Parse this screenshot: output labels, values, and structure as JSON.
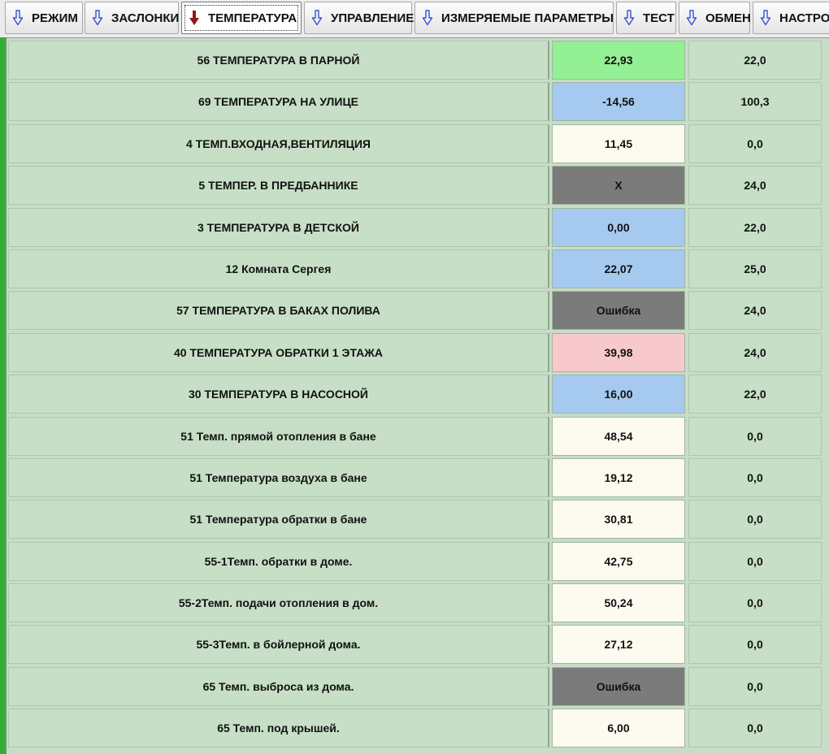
{
  "tabs": [
    {
      "label": "РЕЖИМ",
      "active": false,
      "icon": "arrow-down-icon"
    },
    {
      "label": "ЗАСЛОНКИ",
      "active": false,
      "icon": "arrow-down-icon"
    },
    {
      "label": "ТЕМПЕРАТУРА",
      "active": true,
      "icon": "arrow-down-filled-icon"
    },
    {
      "label": "УПРАВЛЕНИЕ",
      "active": false,
      "icon": "arrow-down-icon"
    },
    {
      "label": "ИЗМЕРЯЕМЫЕ ПАРАМЕТРЫ",
      "active": false,
      "icon": "arrow-down-icon"
    },
    {
      "label": "ТЕСТ",
      "active": false,
      "icon": "arrow-down-icon"
    },
    {
      "label": "ОБМЕН",
      "active": false,
      "icon": "arrow-down-icon"
    },
    {
      "label": "НАСТРО",
      "active": false,
      "icon": "arrow-down-icon"
    }
  ],
  "colors": {
    "green": "#94f094",
    "blue": "#a6c9ef",
    "white": "#fdfaf0",
    "gray": "#7b7b7b",
    "pink": "#f7c9cc",
    "row_bg": "#c6dfc6",
    "active_arrow": "#8b1a1a",
    "inactive_arrow": "#3a4fd8"
  },
  "rows": [
    {
      "name": "56 ТЕМПЕРАТУРА В ПАРНОЙ",
      "value": "22,93",
      "status": "green",
      "setpoint": "22,0"
    },
    {
      "name": "69 ТЕМПЕРАТУРА НА УЛИЦЕ",
      "value": "-14,56",
      "status": "blue",
      "setpoint": "100,3"
    },
    {
      "name": "4 ТЕМП.ВХОДНАЯ,ВЕНТИЛЯЦИЯ",
      "value": "11,45",
      "status": "white",
      "setpoint": "0,0"
    },
    {
      "name": "5 ТЕМПЕР. В ПРЕДБАННИКЕ",
      "value": "X",
      "status": "gray",
      "setpoint": "24,0"
    },
    {
      "name": "3 ТЕМПЕРАТУРА В ДЕТСКОЙ",
      "value": "0,00",
      "status": "blue",
      "setpoint": "22,0"
    },
    {
      "name": "12 Комната Сергея",
      "value": "22,07",
      "status": "blue",
      "setpoint": "25,0"
    },
    {
      "name": "57 ТЕМПЕРАТУРА В БАКАХ ПОЛИВА",
      "value": "Ошибка",
      "status": "gray",
      "setpoint": "24,0"
    },
    {
      "name": "40 ТЕМПЕРАТУРА ОБРАТКИ 1 ЭТАЖА",
      "value": "39,98",
      "status": "pink",
      "setpoint": "24,0"
    },
    {
      "name": "30 ТЕМПЕРАТУРА В НАСОСНОЙ",
      "value": "16,00",
      "status": "blue",
      "setpoint": "22,0"
    },
    {
      "name": "51 Темп. прямой отопления в бане",
      "value": "48,54",
      "status": "white",
      "setpoint": "0,0"
    },
    {
      "name": "51 Температура воздуха в бане",
      "value": "19,12",
      "status": "white",
      "setpoint": "0,0"
    },
    {
      "name": "51 Температура обратки в бане",
      "value": "30,81",
      "status": "white",
      "setpoint": "0,0"
    },
    {
      "name": "55-1Темп. обратки в доме.",
      "value": "42,75",
      "status": "white",
      "setpoint": "0,0"
    },
    {
      "name": "55-2Темп. подачи отопления в дом.",
      "value": "50,24",
      "status": "white",
      "setpoint": "0,0"
    },
    {
      "name": "55-3Темп. в бойлерной дома.",
      "value": "27,12",
      "status": "white",
      "setpoint": "0,0"
    },
    {
      "name": "65 Темп. выброса из дома.",
      "value": "Ошибка",
      "status": "gray",
      "setpoint": "0,0"
    },
    {
      "name": "65 Темп. под крышей.",
      "value": "6,00",
      "status": "white",
      "setpoint": "0,0"
    }
  ]
}
